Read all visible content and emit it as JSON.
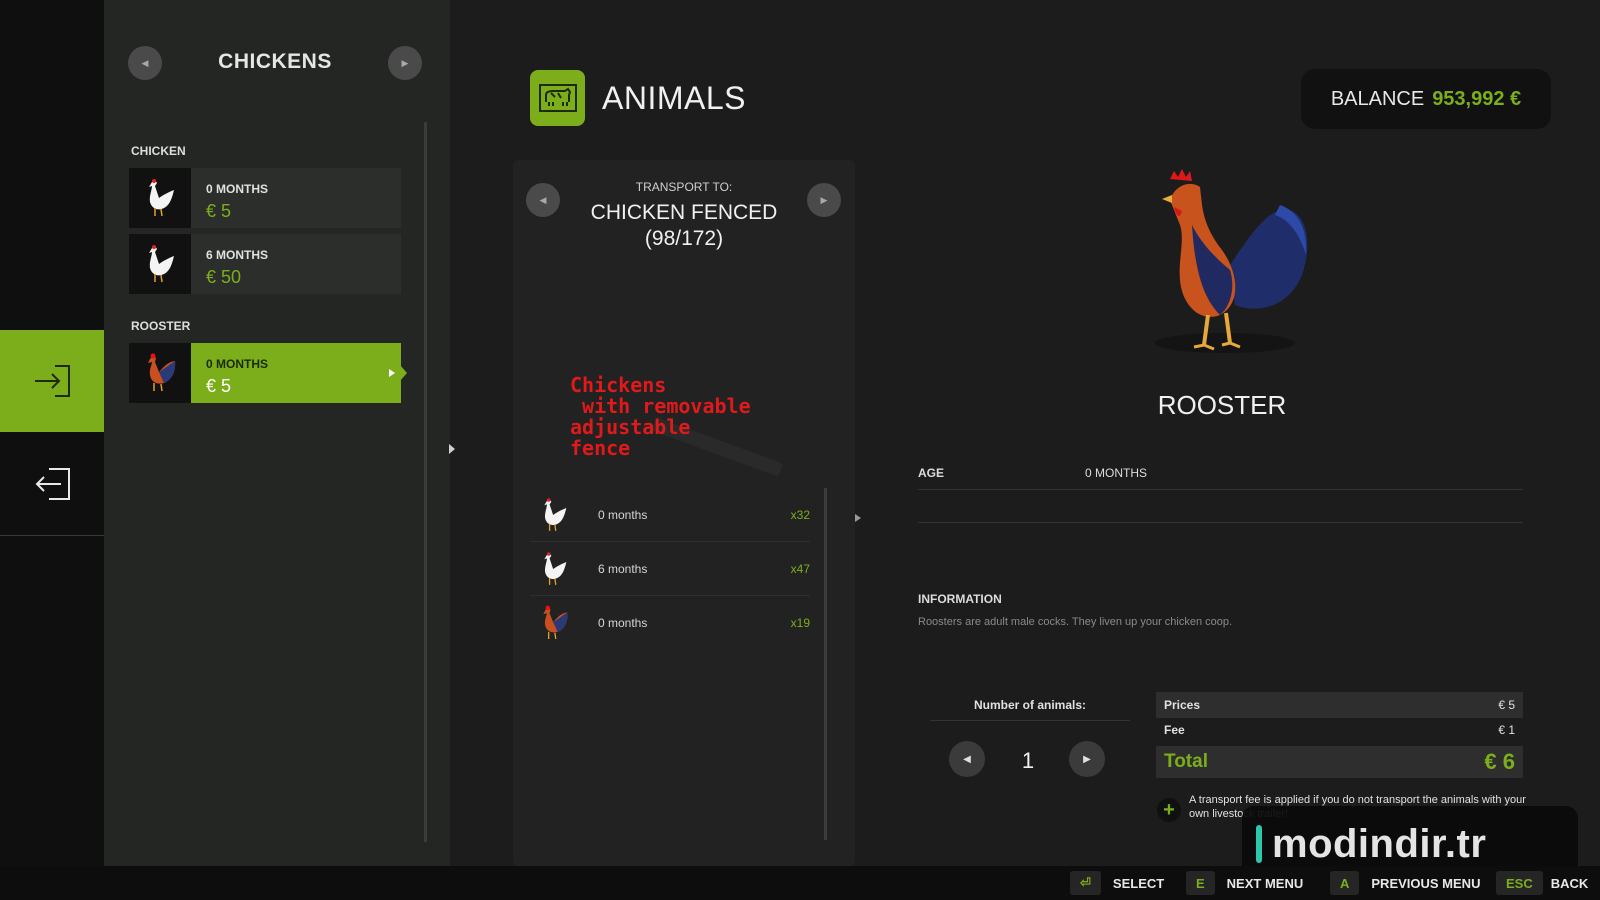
{
  "sidebar": {
    "title": "CHICKENS",
    "groups": [
      {
        "label": "CHICKEN",
        "items": [
          {
            "age": "0 MONTHS",
            "price": "€ 5"
          },
          {
            "age": "6 MONTHS",
            "price": "€ 50"
          }
        ]
      },
      {
        "label": "ROOSTER",
        "items": [
          {
            "age": "0 MONTHS",
            "price": "€ 5",
            "selected": true
          }
        ]
      }
    ]
  },
  "header": {
    "title": "ANIMALS",
    "balance_label": "BALANCE",
    "balance_value": "953,992 €"
  },
  "transport": {
    "label": "TRANSPORT TO:",
    "destination": "CHICKEN FENCED",
    "capacity": "(98/172)",
    "overlay_text": "Chickens\n with removable\nadjustable\nfence",
    "animals": [
      {
        "age": "0 months",
        "count": "x32",
        "icon": "hen-icon"
      },
      {
        "age": "6 months",
        "count": "x47",
        "icon": "hen-icon"
      },
      {
        "age": "0 months",
        "count": "x19",
        "icon": "rooster-icon"
      }
    ]
  },
  "detail": {
    "name": "ROOSTER",
    "age_label": "AGE",
    "age_value": "0 MONTHS",
    "info_heading": "INFORMATION",
    "info_text": "Roosters are adult male cocks. They liven up your chicken coop."
  },
  "purchase": {
    "number_label": "Number of animals:",
    "quantity": "1",
    "prices_label": "Prices",
    "prices_value": "€ 5",
    "fee_label": "Fee",
    "fee_value": "€ 1",
    "total_label": "Total",
    "total_value": "€ 6",
    "note": "A transport fee is applied if you do not transport the animals with your own livestock trailer!"
  },
  "watermark": "modindir.tr",
  "hints": [
    {
      "key": "⏎",
      "label": "SELECT"
    },
    {
      "key": "E",
      "label": "NEXT MENU"
    },
    {
      "key": "A",
      "label": "PREVIOUS MENU"
    },
    {
      "key": "ESC",
      "label": "BACK"
    }
  ],
  "colors": {
    "accent": "#7cae1c",
    "overlay": "#e01a1a",
    "background": "#1c1c1c"
  }
}
